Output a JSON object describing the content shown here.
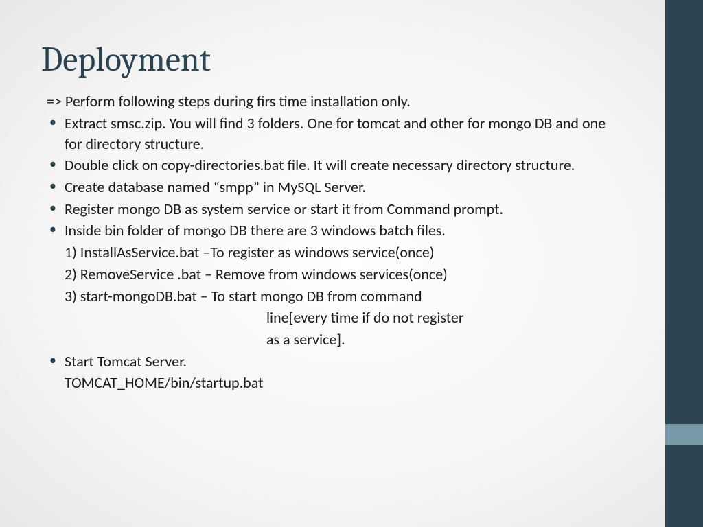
{
  "slide": {
    "title": "Deployment",
    "intro": "=> Perform following steps during firs time installation only.",
    "bullets": [
      "Extract smsc.zip. You will find 3 folders. One for tomcat and other for mongo DB and one for directory structure.",
      "Double click on copy-directories.bat file. It will create necessary directory structure.",
      "Create database named “smpp” in MySQL Server.",
      "Register mongo DB as system service or start it from Command prompt.",
      "Inside bin folder of mongo DB there are 3 windows batch files."
    ],
    "numbered": [
      "1) InstallAsService.bat –To register as windows service(once)",
      "2) RemoveService .bat – Remove from windows services(once)",
      "3) start-mongoDB.bat – To start mongo DB from command"
    ],
    "indented": [
      "line[every time if do not register",
      "as a service]."
    ],
    "bullets2": [
      "Start Tomcat Server."
    ],
    "trailing": "TOMCAT_HOME/bin/startup.bat"
  }
}
